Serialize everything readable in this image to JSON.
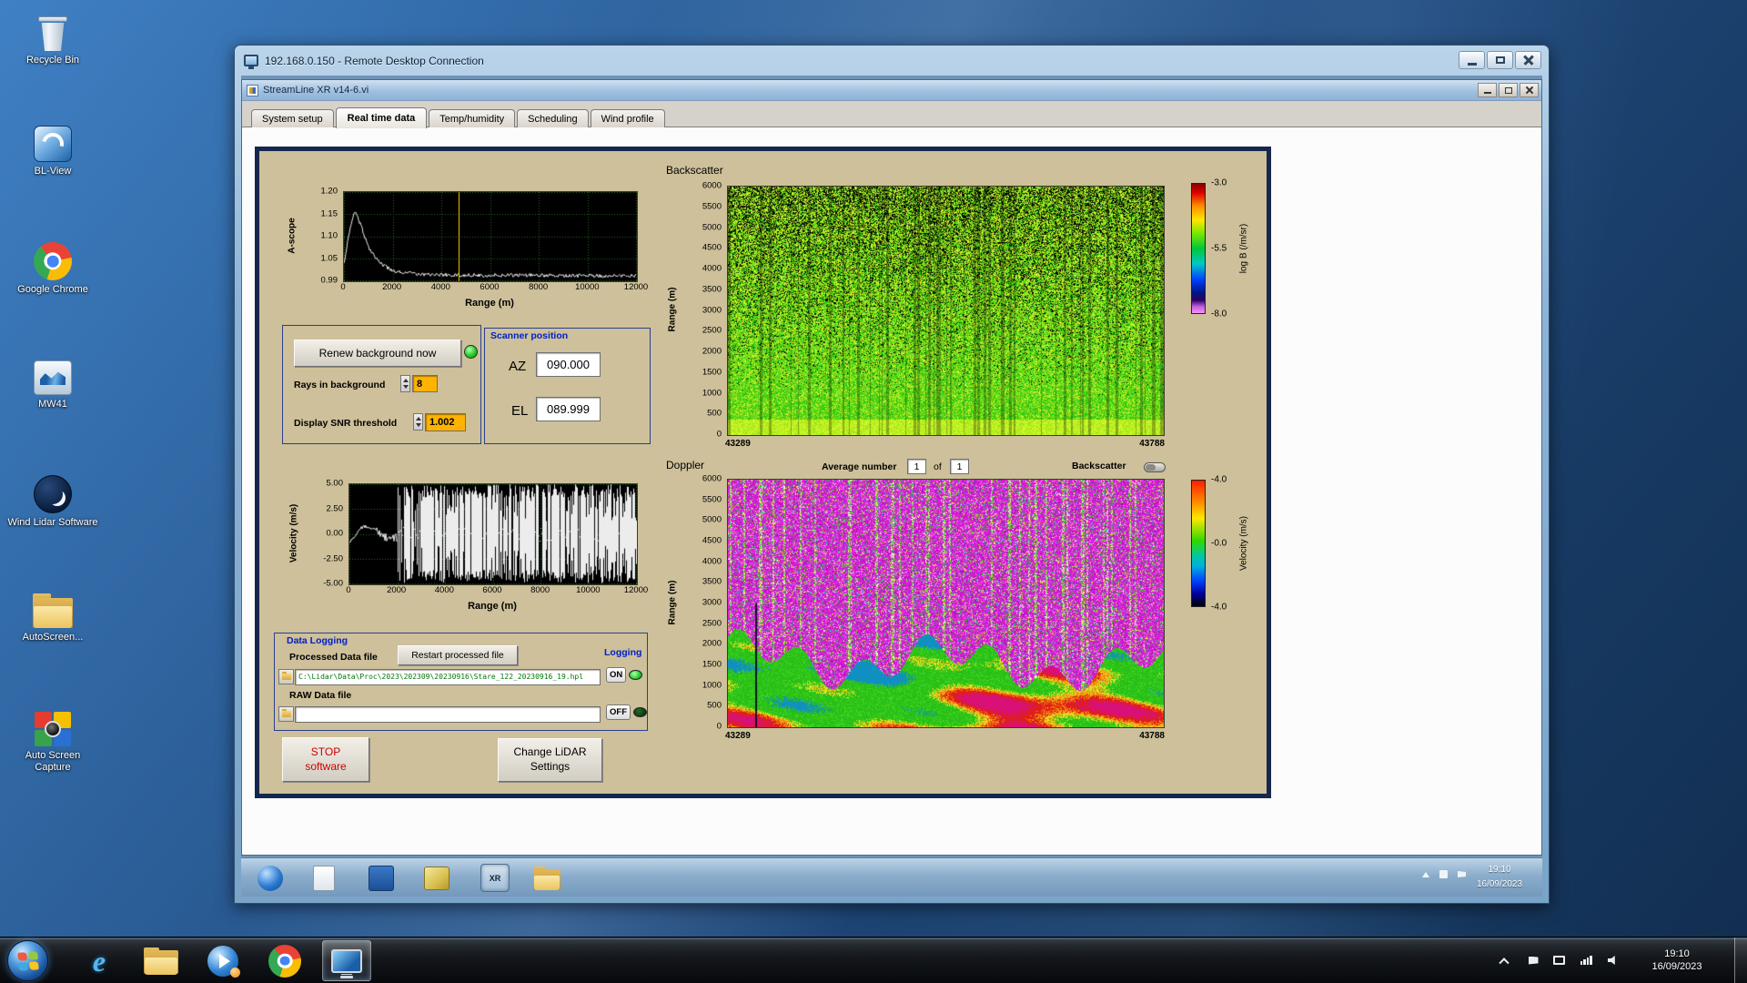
{
  "desktop": {
    "icons": [
      {
        "name": "recycle-bin",
        "label": "Recycle Bin"
      },
      {
        "name": "bl-view",
        "label": "BL-View"
      },
      {
        "name": "google-chrome",
        "label": "Google Chrome"
      },
      {
        "name": "mw41",
        "label": "MW41"
      },
      {
        "name": "wind-lidar-software",
        "label": "Wind Lidar Software"
      },
      {
        "name": "autoscreen",
        "label": "AutoScreen..."
      },
      {
        "name": "auto-screen-capture",
        "label": "Auto Screen Capture"
      }
    ]
  },
  "rdp_window": {
    "title": "192.168.0.150 - Remote Desktop Connection"
  },
  "app_window": {
    "title": "StreamLine XR v14-6.vi",
    "tabs": [
      "System setup",
      "Real time data",
      "Temp/humidity",
      "Scheduling",
      "Wind profile"
    ],
    "active_tab": "Real time data"
  },
  "panel": {
    "renew_button": "Renew background now",
    "rays_label": "Rays in background",
    "rays_value": "8",
    "snr_label": "Display SNR threshold",
    "snr_value": "1.002",
    "scanner": {
      "title": "Scanner position",
      "az_label": "AZ",
      "az_value": "090.000",
      "el_label": "EL",
      "el_value": "089.999"
    },
    "doppler_header": {
      "average_label": "Average number",
      "average_value": "1",
      "of_label": "of",
      "count_value": "1",
      "backscatter_label": "Backscatter"
    },
    "logging": {
      "title": "Data Logging",
      "processed_label": "Processed Data file",
      "restart_button": "Restart processed file",
      "logging_label": "Logging",
      "processed_path": "C:\\Lidar\\Data\\Proc\\2023\\202309\\20230916\\Stare_122_20230916_19.hpl",
      "on_label": "ON",
      "raw_label": "RAW Data file",
      "raw_path": "",
      "off_label": "OFF"
    },
    "stop_line1": "STOP",
    "stop_line2": "software",
    "settings_line1": "Change LiDAR",
    "settings_line2": "Settings"
  },
  "remote_taskbar": {
    "time": "19:10",
    "date": "16/09/2023",
    "xr_badge": "XR"
  },
  "taskbar": {
    "time": "19:10",
    "date": "16/09/2023",
    "ie_glyph": "e"
  },
  "chart_data": [
    {
      "id": "a-scope",
      "type": "line",
      "xlabel": "Range (m)",
      "ylabel": "A-scope",
      "xlim": [
        0,
        12000
      ],
      "ylim": [
        0.99,
        1.2
      ],
      "xticks": [
        "0",
        "2000",
        "4000",
        "6000",
        "8000",
        "10000",
        "12000"
      ],
      "yticks": [
        "1.20",
        "1.15",
        "1.10",
        "1.05",
        "0.99"
      ],
      "cursor_x": 4700,
      "grid": true,
      "plot_bg": "#000000",
      "line_color": "#ffffff",
      "series": [
        {
          "name": "a-scope-trace",
          "x": [
            0,
            200,
            450,
            700,
            1000,
            1500,
            2000,
            3000,
            4000,
            6000,
            8000,
            10000,
            12000
          ],
          "y": [
            1.03,
            1.1,
            1.155,
            1.12,
            1.07,
            1.03,
            1.012,
            1.005,
            1.003,
            1.002,
            1.002,
            1.001,
            1.001
          ]
        }
      ]
    },
    {
      "id": "velocity",
      "type": "line",
      "xlabel": "Range (m)",
      "ylabel": "Velocity (m/s)",
      "xlim": [
        0,
        12000
      ],
      "ylim": [
        -5,
        5
      ],
      "xticks": [
        "0",
        "2000",
        "4000",
        "6000",
        "8000",
        "10000",
        "12000"
      ],
      "yticks": [
        "5.00",
        "2.50",
        "0.00",
        "-2.50",
        "-5.00"
      ],
      "grid": true,
      "plot_bg": "#000000",
      "line_color": "#ffffff",
      "spike_region_start_x": 2000,
      "spike_amplitude": 5,
      "series": [
        {
          "name": "velocity-trace",
          "note": "mean velocity near 0 m/s below ~2000 m; saturated uncorrelated spikes spanning -5..+5 m/s beyond 2000 m"
        }
      ]
    },
    {
      "id": "backscatter",
      "type": "heatmap",
      "title": "Backscatter",
      "ylabel": "Range (m)",
      "ylim": [
        0,
        6000
      ],
      "yticks": [
        "6000",
        "5500",
        "5000",
        "4500",
        "4000",
        "3500",
        "3000",
        "2500",
        "2000",
        "1500",
        "1000",
        "500",
        "0"
      ],
      "xticks": [
        "43289",
        "43788"
      ],
      "colorbar": {
        "label": "log B (/m/sr)",
        "ticks": [
          "-3.0",
          "-5.5",
          "-8.0"
        ],
        "min": -8,
        "max": -3
      },
      "summary": "aerosol backscatter time-height plot: bright yellow-green band below ~500 m, speckled green/yellow field with black dropouts increasing toward 6000 m"
    },
    {
      "id": "doppler",
      "type": "heatmap",
      "title": "Doppler",
      "ylabel": "Range (m)",
      "ylim": [
        0,
        6000
      ],
      "yticks": [
        "6000",
        "5500",
        "5000",
        "4500",
        "4000",
        "3500",
        "3000",
        "2500",
        "2000",
        "1500",
        "1000",
        "500",
        "0"
      ],
      "xticks": [
        "43289",
        "43788"
      ],
      "colorbar": {
        "label": "Velocity (m/s)",
        "ticks": [
          "-4.0",
          "-0.0",
          "-4.0"
        ],
        "min": -4,
        "max": 4
      },
      "summary": "Doppler velocity time-height plot: coherent green velocities with red/orange/magenta patches below ~2000 m, uncorrelated magenta noise aloft with vertical streaks"
    }
  ]
}
